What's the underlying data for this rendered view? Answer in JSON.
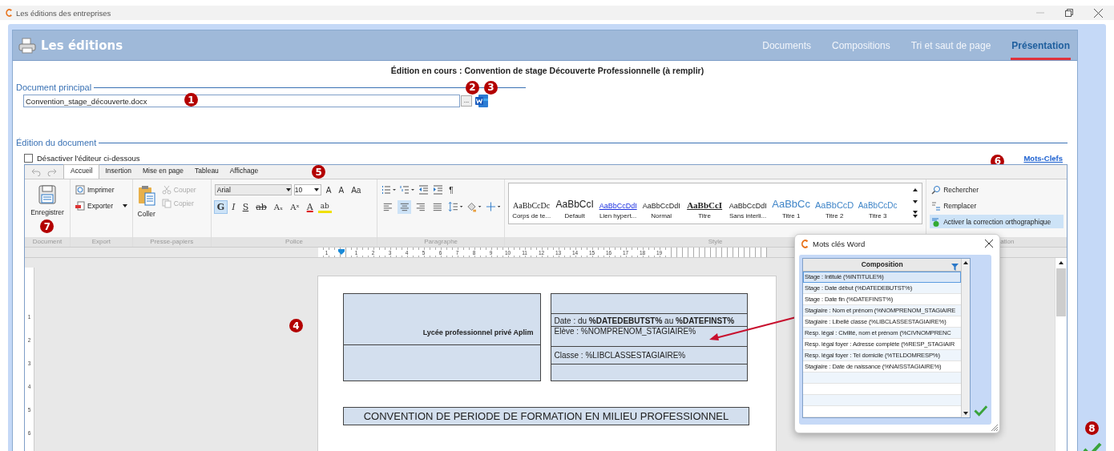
{
  "window": {
    "title": "Les éditions des entreprises"
  },
  "header": {
    "title": "Les éditions",
    "tabs": [
      {
        "label": "Documents",
        "selected": false
      },
      {
        "label": "Compositions",
        "selected": false
      },
      {
        "label": "Tri et saut de page",
        "selected": false
      },
      {
        "label": "Présentation",
        "selected": true
      }
    ]
  },
  "current_edition": "Édition en cours : Convention de stage Découverte Professionnelle (à remplir)",
  "main_document": {
    "section_title": "Document principal",
    "file": "Convention_stage_découverte.docx",
    "browse_button": "...",
    "callouts": [
      "1",
      "2",
      "3"
    ]
  },
  "editor_section": {
    "section_title": "Édition du document",
    "disable_checkbox": {
      "label": "Désactiver l'éditeur ci-dessous",
      "checked": false
    },
    "keywords_link": "Mots-Clefs",
    "callout": "6"
  },
  "ribbon": {
    "tabs": [
      {
        "label": "Accueil",
        "selected": true
      },
      {
        "label": "Insertion",
        "selected": false
      },
      {
        "label": "Mise en page",
        "selected": false
      },
      {
        "label": "Tableau",
        "selected": false
      },
      {
        "label": "Affichage",
        "selected": false
      }
    ],
    "tabs_callout": "5",
    "document": {
      "label": "Document",
      "save": "Enregistrer",
      "callout": "7"
    },
    "export": {
      "label": "Export",
      "items": [
        "Imprimer",
        "Exporter"
      ]
    },
    "clipboard": {
      "label": "Presse-papiers",
      "paste": "Coller",
      "items": [
        {
          "label": "Couper",
          "disabled": true
        },
        {
          "label": "Copier",
          "disabled": true
        }
      ]
    },
    "font": {
      "label": "Police",
      "font_name": "Arial",
      "font_size": "10",
      "size_buttons": [
        "A",
        "A",
        "Aa"
      ],
      "format_buttons": [
        {
          "label": "G",
          "kind": "bold",
          "selected": true
        },
        {
          "label": "I",
          "kind": "italic",
          "selected": false
        },
        {
          "label": "S",
          "kind": "underline",
          "selected": false
        },
        {
          "label": "ab",
          "kind": "strike",
          "selected": false
        },
        {
          "label": "Aₓ",
          "kind": "subscript",
          "selected": false
        },
        {
          "label": "Aˣ",
          "kind": "superscript",
          "selected": false
        },
        {
          "label": "A",
          "kind": "color",
          "selected": false
        },
        {
          "label": "ab",
          "kind": "highlight",
          "selected": false
        }
      ]
    },
    "paragraph": {
      "label": "Paragraphe",
      "pilcrow": "¶",
      "alignments": [
        {
          "selected": false
        },
        {
          "selected": true
        },
        {
          "selected": false
        },
        {
          "selected": false
        }
      ]
    },
    "style": {
      "label": "Style",
      "items": [
        {
          "sample": "AaBbCcDc",
          "name": "Corps de te...",
          "kind": "body"
        },
        {
          "sample": "AaBbCcI",
          "name": "Default",
          "kind": "default"
        },
        {
          "sample": "AaBbCcDdI",
          "name": "Lien hypert...",
          "kind": "link"
        },
        {
          "sample": "AaBbCcDdI",
          "name": "Normal",
          "kind": "normal"
        },
        {
          "sample": "AaBbCcI",
          "name": "Titre",
          "kind": "title"
        },
        {
          "sample": "AaBbCcDdI",
          "name": "Sans interli...",
          "kind": "normal"
        },
        {
          "sample": "AaBbCc",
          "name": "Titre 1",
          "kind": "h1"
        },
        {
          "sample": "AaBbCcD",
          "name": "Titre 2",
          "kind": "h2"
        },
        {
          "sample": "AaBbCcDc",
          "name": "Titre 3",
          "kind": "h3"
        }
      ]
    },
    "edition": {
      "label": "ation",
      "items": [
        {
          "label": "Rechercher",
          "kind": "search",
          "selected": false
        },
        {
          "label": "Remplacer",
          "kind": "replace",
          "selected": false
        },
        {
          "label": "Activer la correction orthographique",
          "kind": "spell",
          "selected": true
        }
      ]
    }
  },
  "ruler": {
    "horizontal": [
      "1",
      "1",
      "2",
      "3",
      "4",
      "5",
      "6",
      "7",
      "8",
      "9",
      "10",
      "11",
      "12",
      "13",
      "14",
      "15",
      "16",
      "17",
      "18",
      "19"
    ],
    "vertical": [
      "1",
      "2",
      "3",
      "4",
      "5",
      "6"
    ]
  },
  "document_page": {
    "callout": "4",
    "school": "Lycée professionnel privé Aplim",
    "info_cells": [
      "",
      "Date : du **%DATEDEBUTST%** au **%DATEFINST%**",
      "Elève : %NOMPRENOM_STAGIAIRE%",
      "Classe : %LIBCLASSESTAGIAIRE%",
      ""
    ],
    "title": "CONVENTION DE PERIODE DE FORMATION EN MILIEU PROFESSIONNEL"
  },
  "keywords_dialog": {
    "title": "Mots clés Word",
    "column": "Composition",
    "rows": [
      {
        "text": "Stage : Intitulé (%INTITULE%)",
        "selected": true
      },
      {
        "text": "Stage : Date début (%DATEDEBUTST%)",
        "selected": false
      },
      {
        "text": "Stage : Date fin (%DATEFINST%)",
        "selected": false
      },
      {
        "text": "Stagiaire : Nom et prénom (%NOMPRENOM_STAGIAIRE",
        "selected": false
      },
      {
        "text": "Stagiaire : Libellé classe (%LIBCLASSESTAGIAIRE%)",
        "selected": false
      },
      {
        "text": "Resp. légal : Civilité, nom et prénom (%CIVNOMPRENC",
        "selected": false
      },
      {
        "text": "Resp. légal foyer : Adresse complète (%RESP_STAGIAIR",
        "selected": false
      },
      {
        "text": "Resp. légal foyer : Tel domicile (%TELDOMRESP%)",
        "selected": false
      },
      {
        "text": "Stagiaire : Date de naissance (%NAISSTAGIAIRE%)",
        "selected": false
      }
    ]
  },
  "confirm_callout": "8"
}
